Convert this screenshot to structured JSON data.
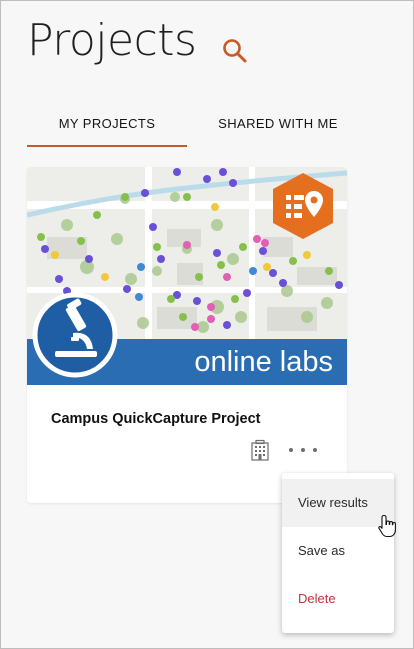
{
  "page": {
    "title": "Projects"
  },
  "tabs": [
    {
      "label": "MY PROJECTS",
      "active": true
    },
    {
      "label": "SHARED WITH ME",
      "active": false
    }
  ],
  "project_card": {
    "title": "Campus QuickCapture Project",
    "thumbnail_banner": "online labs",
    "thumbnail_icons": [
      "microscope-icon",
      "quickcapture-app-icon"
    ],
    "actions": [
      "building-icon",
      "more-options-icon"
    ]
  },
  "context_menu": {
    "items": [
      {
        "label": "View results",
        "hovered": true
      },
      {
        "label": "Save as",
        "hovered": false
      },
      {
        "label": "Delete",
        "hovered": false,
        "destructive": true
      }
    ]
  },
  "colors": {
    "accent": "#c85a27",
    "danger": "#c4323f",
    "banner_blue": "#2a6db3",
    "app_icon_orange": "#e46f1f"
  }
}
